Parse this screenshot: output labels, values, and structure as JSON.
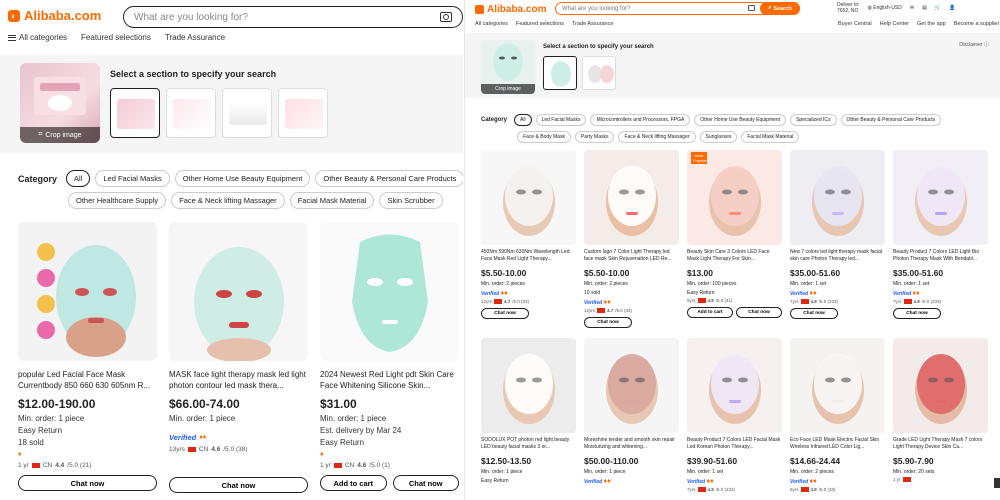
{
  "left": {
    "logo": "Alibaba.com",
    "search_placeholder": "What are you looking for?",
    "nav": [
      "All categories",
      "Featured selections",
      "Trade Assurance"
    ],
    "section_title": "Select a section to specify your search",
    "crop_label": "Crop image",
    "category_title": "Category",
    "categories_row1": [
      "All",
      "Led Facial Masks",
      "Other Home Use Beauty Equipment",
      "Other Beauty & Personal Care Products"
    ],
    "categories_row2": [
      "Other Healthcare Supply",
      "Face & Neck lifting Massager",
      "Facial Mask Material",
      "Skin Scrubber"
    ],
    "products": [
      {
        "title": "popular Led Facial Face Mask Currentbody 850 660 630 605nm R...",
        "price": "$12.00-190.00",
        "moq": "Min. order: 1 piece",
        "extra1": "Easy Return",
        "extra2": "18 sold",
        "verified": "",
        "years": "1 yr",
        "country": "CN",
        "rating": "4.4",
        "reviews": "/5.0 (21)",
        "buttons": [
          "Chat now"
        ]
      },
      {
        "title": "MASK face light therapy mask led light photon contour led mask thera...",
        "price": "$66.00-74.00",
        "moq": "Min. order: 1 piece",
        "extra1": "",
        "extra2": "",
        "verified": "Verified",
        "years": "13yrs",
        "country": "CN",
        "rating": "4.6",
        "reviews": "/5.0 (38)",
        "buttons": [
          "Chat now"
        ]
      },
      {
        "title": "2024 Newest Red Light pdt Skin Care Face Whitening Silicone Skin...",
        "price": "$31.00",
        "moq": "Min. order: 1 piece",
        "extra1": "Est. delivery by Mar 24",
        "extra2": "Easy Return",
        "verified": "",
        "years": "1 yr",
        "country": "CN",
        "rating": "4.6",
        "reviews": "/5.0 (1)",
        "buttons": [
          "Add to cart",
          "Chat now"
        ]
      }
    ]
  },
  "right": {
    "logo": "Alibaba.com",
    "search_placeholder": "What are you looking for?",
    "search_button": "Search",
    "deliver_to": "Deliver to:",
    "deliver_loc": "7652, NO",
    "language": "English-USD",
    "nav": [
      "All categories",
      "Featured selections",
      "Trade Assurance"
    ],
    "nav_right": [
      "Buyer Central",
      "Help Center",
      "Get the app",
      "Become a supplier"
    ],
    "section_title": "Select a section to specify your search",
    "crop_label": "Crop image",
    "disclaimer": "Disclaimer",
    "category_title": "Category",
    "categories_row1": [
      "All",
      "Led Facial Masks",
      "Microcontrollers and Processors, FPGA",
      "Other Home Use Beauty Equipment",
      "Specialized ICs",
      "Other Beauty & Personal Care Products"
    ],
    "categories_row2": [
      "Face & Body Mask",
      "Party Masks",
      "Face & Neck lifting Massager",
      "Sunglasses",
      "Facial Mask Material"
    ],
    "products": [
      {
        "title": "450Nm 590Nm 630Nm Wavelength Led Face Mask Red Light Therapy...",
        "price": "$5.50-10.00",
        "moq": "Min. order: 2 pieces",
        "extra": "",
        "verified": "Verified",
        "years": "12yrs",
        "rating": "4.7",
        "reviews": "/5.0 (33)",
        "buttons": [
          "Chat now"
        ],
        "hot": ""
      },
      {
        "title": "Custom logo 7 Color Light Therapy led face mask Skin Rejuvenation LED Re...",
        "price": "$5.50-10.00",
        "moq": "Min. order: 2 pieces",
        "extra": "10 sold",
        "verified": "Verified",
        "years": "12yrs",
        "rating": "4.7",
        "reviews": "/5.0 (33)",
        "buttons": [
          "Chat now"
        ],
        "hot": ""
      },
      {
        "title": "Beauty Skin Care 3 Colors LED Face Mask Light Therapy For Skin...",
        "price": "$13.00",
        "moq": "Min. order: 100 pieces",
        "extra": "Easy Return",
        "verified": "",
        "years": "5yrs",
        "rating": "4.8",
        "reviews": "/5.0 (41)",
        "buttons": [
          "Add to cart",
          "Chat now"
        ],
        "hot": "Most Popular"
      },
      {
        "title": "New 7 colors led light therapy mask facial skin care Photon Therapy led...",
        "price": "$35.00-51.60",
        "moq": "Min. order: 1 set",
        "extra": "",
        "verified": "Verified",
        "years": "7yrs",
        "rating": "4.8",
        "reviews": "/5.0 (233)",
        "buttons": [
          "Chat now"
        ],
        "hot": ""
      },
      {
        "title": "Beauty Product 7 Colors LED Light Bio Photon Therapy Mask With Bendabl...",
        "price": "$35.00-51.60",
        "moq": "Min. order: 1 set",
        "extra": "",
        "verified": "Verified",
        "years": "7yrs",
        "rating": "4.8",
        "reviews": "/5.0 (233)",
        "buttons": [
          "Chat now"
        ],
        "hot": ""
      },
      {
        "title": "SODOLUX POT photon red light beauty LED beauty facial masks 3 or...",
        "price": "$12.50-13.50",
        "moq": "Min. order: 1 piece",
        "extra": "Easy Return",
        "verified": "",
        "years": "",
        "rating": "",
        "reviews": "",
        "buttons": [],
        "hot": ""
      },
      {
        "title": "Moreshine tender and smooth skin repair Moisturizing and whitening...",
        "price": "$50.00-110.00",
        "moq": "Min. order: 1 piece",
        "extra": "",
        "verified": "Verified",
        "years": "",
        "rating": "",
        "reviews": "",
        "buttons": [],
        "hot": ""
      },
      {
        "title": "Beauty Product 7 Colors LED Facial Mask Led Korean Photon Therapy...",
        "price": "$39.90-51.60",
        "moq": "Min. order: 1 set",
        "extra": "",
        "verified": "Verified",
        "years": "7yrs",
        "rating": "4.8",
        "reviews": "/5.0 (233)",
        "buttons": [],
        "hot": ""
      },
      {
        "title": "Eco Face LED Mask Electric Facial Skin Wireless Infrared LED Color Lig...",
        "price": "$14.66-24.44",
        "moq": "Min. order: 2 pieces",
        "extra": "",
        "verified": "Verified",
        "years": "6yrs",
        "rating": "4.8",
        "reviews": "/5.0 (33)",
        "buttons": [],
        "hot": ""
      },
      {
        "title": "Grade LED Light Therapy Mask 7 colors Light Therapy Device Skin Ca...",
        "price": "$5.90-7.90",
        "moq": "Min. order: 20 sets",
        "extra": "",
        "verified": "",
        "years": "1 yr",
        "rating": "",
        "reviews": "",
        "buttons": [],
        "hot": ""
      }
    ]
  },
  "colors": {
    "brand": "#ff6a00",
    "verified": "#1a5cff"
  }
}
